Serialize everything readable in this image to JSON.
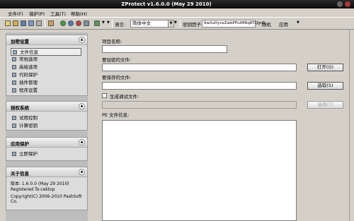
{
  "window": {
    "title": "ZProtect v1.6.0.0 (May 29 2010)"
  },
  "menu": {
    "items": [
      "文件(F)",
      "保护(P)",
      "工具(T)",
      "帮助(H)"
    ]
  },
  "toolbar": {
    "language_label": "语言:",
    "language_value": "简体中文",
    "seed_label": "密钥因子:",
    "seed_value": "6wXxDynzZwbPPutMRqRTQgn5",
    "random_label": "随机",
    "apply_label": "应用"
  },
  "sidebar": {
    "encrypt": {
      "title": "加密设置",
      "items": [
        "文件信息",
        "常规选项",
        "高级选项",
        "代码保护",
        "插件管理",
        "程序设置"
      ]
    },
    "license": {
      "title": "授权系统",
      "items": [
        "试用控制",
        "计算密钥"
      ]
    },
    "apply": {
      "title": "应用保护",
      "items": [
        "立即保护"
      ]
    },
    "about": {
      "title": "关于信息",
      "version": "版本:  1.6.0.0 (May 29 2010)",
      "registered": "Registered To:cektop",
      "copyright": "Copyright(C) 2006-2010 PashSoft Co."
    }
  },
  "main": {
    "project_name_label": "项目名称:",
    "project_name_value": "",
    "encrypt_file_label": "要加密的文件:",
    "encrypt_file_value": "",
    "open_button": "打开(O)",
    "save_file_label": "要保存的文件:",
    "save_file_value": "",
    "choose_button": "选取(S)",
    "debug_checkbox_label": "生成调试文件:",
    "debug_checked": false,
    "debug_file_value": "",
    "choose_debug_button": "选择(T)",
    "pe_info_label": "PE 文件信息:",
    "pe_info_value": ""
  }
}
